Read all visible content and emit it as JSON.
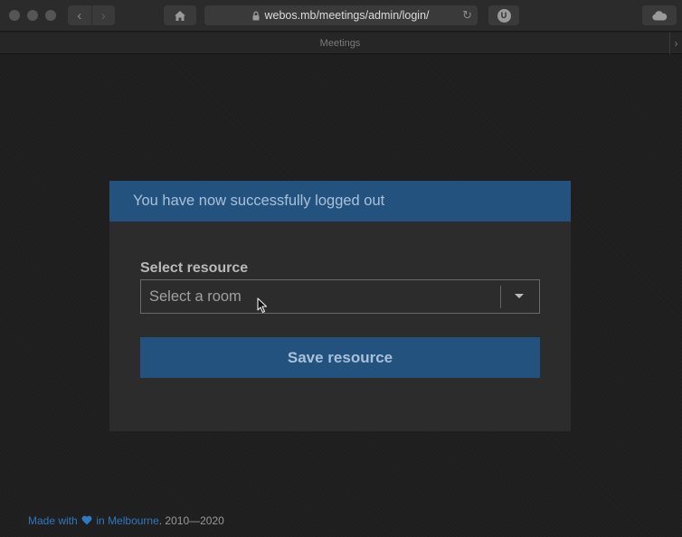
{
  "browser": {
    "url": "webos.mb/meetings/admin/login/",
    "tab_title": "Meetings",
    "back_glyph": "‹",
    "forward_glyph": "›",
    "reload_glyph": "↻",
    "extension_badge": "U",
    "new_tab_glyph": "›",
    "icons": [
      "home-icon",
      "lock-icon",
      "reload-icon",
      "cloud-icon"
    ]
  },
  "alert": {
    "message": "You have now successfully logged out",
    "color": "#23527f"
  },
  "form": {
    "label": "Select resource",
    "select_value": "Select a room",
    "save_button": "Save resource"
  },
  "footer": {
    "made_with": "Made with",
    "in_city": "in Melbourne",
    "years": ". 2010—2020",
    "heart_color": "#2f78c2"
  }
}
